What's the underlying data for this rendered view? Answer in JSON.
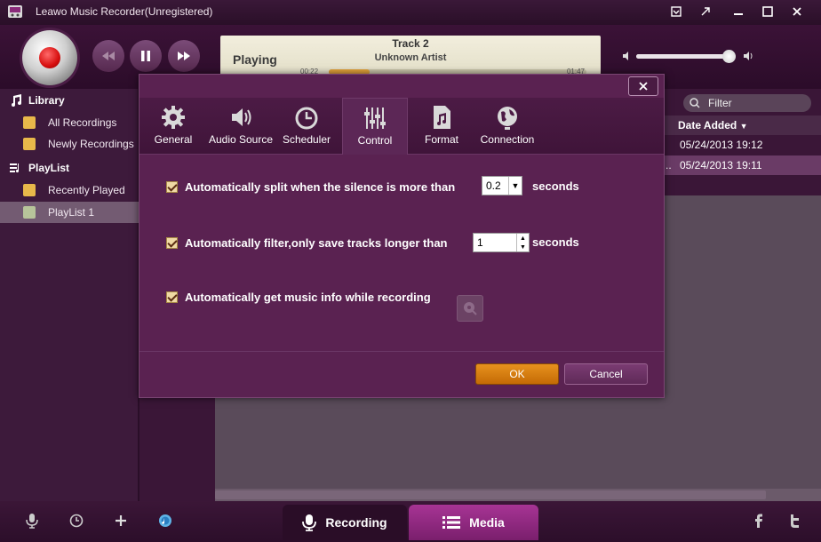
{
  "window": {
    "title": "Leawo Music Recorder(Unregistered)"
  },
  "player": {
    "status": "Playing",
    "track": "Track 2",
    "artist": "Unknown Artist",
    "time_elapsed": "00:22",
    "time_total": "01:47",
    "progress_fraction": 0.16,
    "volume_fraction": 0.93
  },
  "sidebar": {
    "library_label": "Library",
    "library_items": [
      {
        "label": "All Recordings",
        "icon": "folder-icon"
      },
      {
        "label": "Newly Recordings",
        "icon": "star-folder-icon"
      }
    ],
    "playlist_label": "PlayList",
    "playlist_items": [
      {
        "label": "Recently Played",
        "icon": "clock-folder-icon"
      },
      {
        "label": "PlayList 1",
        "icon": "playlist-icon",
        "selected": true
      }
    ]
  },
  "list": {
    "filter_placeholder": "Filter",
    "column_date": "Date Added",
    "rows": [
      {
        "date": "05/24/2013 19:12"
      },
      {
        "prefix": "..",
        "date": "05/24/2013 19:11"
      }
    ]
  },
  "dialog": {
    "tabs": [
      {
        "label": "General",
        "icon": "gear-icon"
      },
      {
        "label": "Audio Source",
        "icon": "speaker-icon"
      },
      {
        "label": "Scheduler",
        "icon": "clock-icon"
      },
      {
        "label": "Control",
        "icon": "sliders-icon",
        "active": true
      },
      {
        "label": "Format",
        "icon": "music-file-icon"
      },
      {
        "label": "Connection",
        "icon": "globe-icon"
      }
    ],
    "option_split": {
      "label": "Automatically split when the silence is more than",
      "value": "0.2",
      "unit": "seconds",
      "checked": true
    },
    "option_filter": {
      "label": "Automatically filter,only save tracks longer than",
      "value": "1",
      "unit": "seconds",
      "checked": true
    },
    "option_info": {
      "label": "Automatically get music info while recording",
      "checked": true
    },
    "ok_label": "OK",
    "cancel_label": "Cancel"
  },
  "bottom": {
    "recording_label": "Recording",
    "media_label": "Media"
  }
}
